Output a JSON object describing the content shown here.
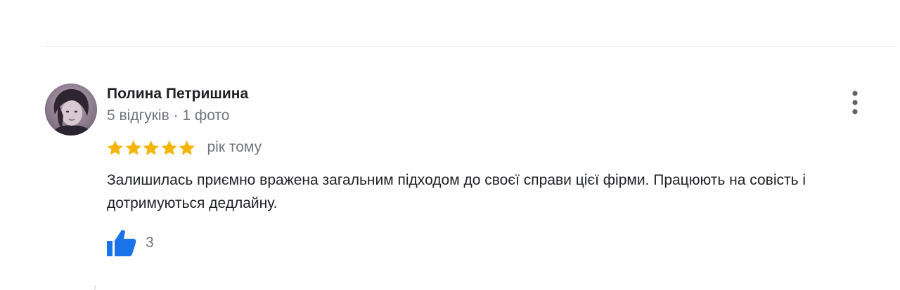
{
  "review": {
    "author": {
      "name": "Полина Петришина",
      "meta": "5 відгуків · 1 фото",
      "avatar": "avatar-photo"
    },
    "rating": {
      "value": 5,
      "max": 5,
      "star_color": "#f4b400"
    },
    "date": "рік тому",
    "text": "Залишилась приємно вражена загальним підходом до своєї справи цієї фірми. Працюють на совість і дотримуються дедлайну.",
    "likes": {
      "icon": "thumbs-up-icon",
      "count": "3",
      "color": "#1a73e8"
    },
    "menu_icon": "more-vert-icon"
  }
}
